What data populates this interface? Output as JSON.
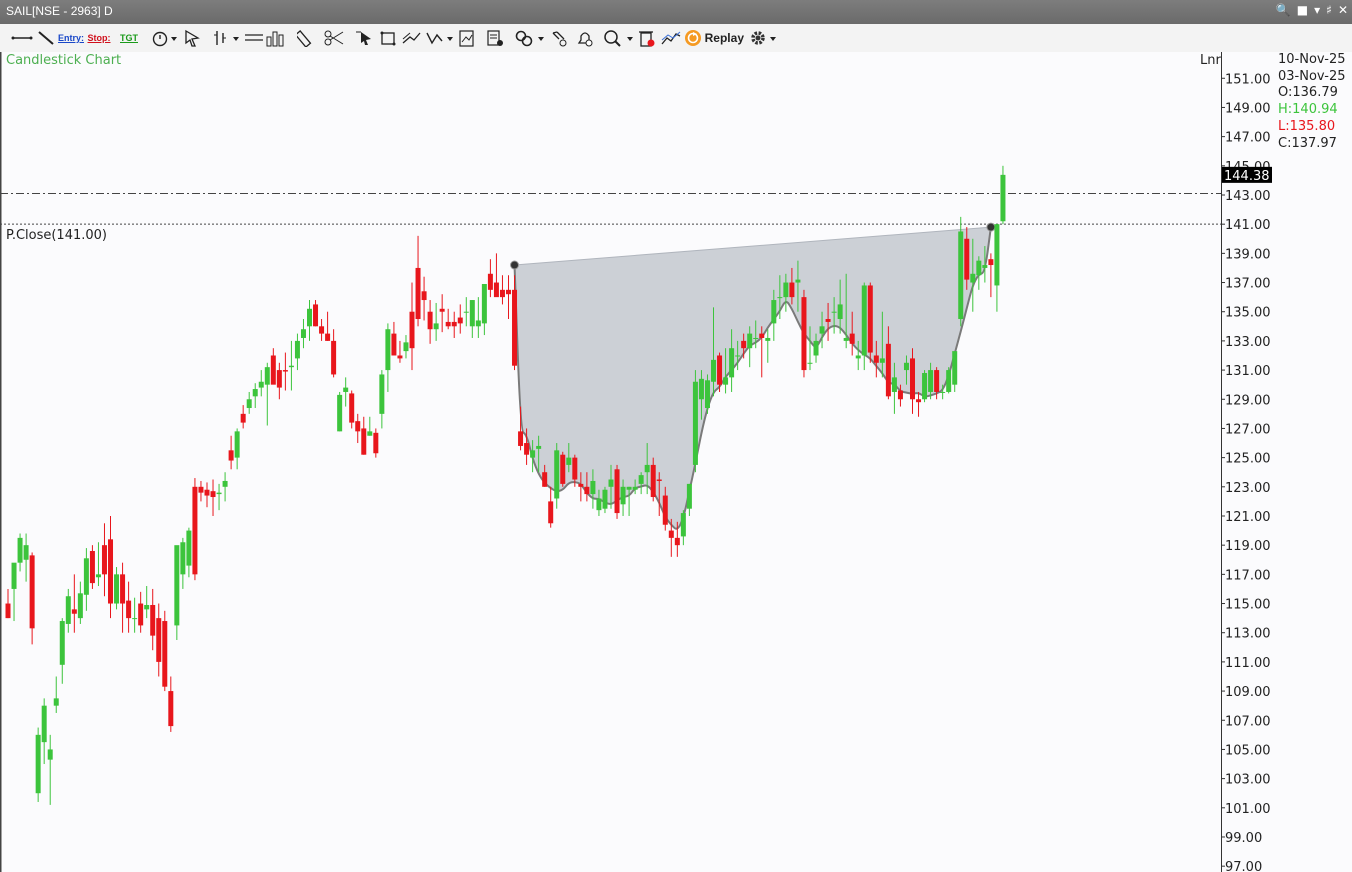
{
  "window": {
    "title": "SAIL[NSE - 2963] D"
  },
  "toolbar": {
    "entry_label": "Entry:",
    "stop_label": "Stop:",
    "tgt_label": "TGT",
    "replay_label": "Replay"
  },
  "header": {
    "chart_label": "Candlestick Chart",
    "scale_label": "Lnr",
    "date_current": "10-Nov-25",
    "date_hover": "03-Nov-25",
    "open": "O:136.79",
    "high": "H:140.94",
    "low": "L:135.80",
    "close": "C:137.97",
    "prev_close": "P.Close(141.00)",
    "last_price": "144.38"
  },
  "colors": {
    "up": "#3cc43c",
    "down": "#e8161c",
    "pattern_fill": "#c3c8cf",
    "pattern_stroke": "#7a7a7a",
    "accent": "#4caf50"
  },
  "chart_data": {
    "type": "candlestick",
    "ylim": [
      96.6,
      152.8
    ],
    "y_ticks": [
      "151.00",
      "149.00",
      "147.00",
      "145.00",
      "143.00",
      "141.00",
      "139.00",
      "137.00",
      "135.00",
      "133.00",
      "131.00",
      "129.00",
      "127.00",
      "125.00",
      "123.00",
      "121.00",
      "119.00",
      "117.00",
      "115.00",
      "113.00",
      "111.00",
      "109.00",
      "107.00",
      "105.00",
      "103.00",
      "101.00",
      "99.00",
      "97.00"
    ],
    "reference_lines": [
      {
        "name": "P.Close",
        "value": 141.0,
        "style": "dotted"
      },
      {
        "value": 143.1,
        "style": "dash-dot"
      }
    ],
    "candles": [
      [
        115.0,
        116.0,
        114.0,
        114.0
      ],
      [
        116.0,
        117.6,
        113.8,
        117.8
      ],
      [
        117.8,
        119.8,
        117.2,
        119.5
      ],
      [
        118.0,
        119.8,
        116.5,
        119.0
      ],
      [
        118.3,
        118.5,
        112.2,
        113.3
      ],
      [
        102.0,
        106.5,
        101.4,
        106.0
      ],
      [
        105.5,
        108.5,
        104.0,
        108.0
      ],
      [
        104.3,
        106.0,
        101.2,
        105.0
      ],
      [
        108.0,
        110.0,
        107.5,
        108.5
      ],
      [
        110.8,
        114.0,
        109.5,
        113.8
      ],
      [
        113.6,
        116.0,
        113.0,
        115.5
      ],
      [
        114.6,
        117.0,
        113.0,
        114.3
      ],
      [
        114.0,
        116.5,
        113.6,
        115.7
      ],
      [
        115.6,
        118.8,
        114.5,
        118.1
      ],
      [
        118.6,
        119.0,
        116.0,
        116.4
      ],
      [
        116.8,
        119.2,
        116.2,
        117.0
      ],
      [
        119.0,
        120.5,
        115.5,
        117.0
      ],
      [
        119.4,
        121.0,
        114.0,
        115.0
      ],
      [
        115.0,
        117.5,
        114.6,
        117.0
      ],
      [
        117.0,
        117.8,
        113.0,
        115.0
      ],
      [
        115.2,
        116.5,
        113.0,
        114.0
      ],
      [
        114.0,
        115.4,
        113.0,
        114.0
      ],
      [
        115.0,
        115.8,
        113.0,
        113.5
      ],
      [
        114.6,
        116.2,
        114.0,
        114.9
      ],
      [
        114.9,
        116.0,
        111.8,
        112.8
      ],
      [
        114.0,
        115.0,
        110.0,
        111.0
      ],
      [
        113.8,
        114.5,
        109.0,
        109.3
      ],
      [
        109.0,
        110.0,
        106.2,
        106.6
      ],
      [
        113.5,
        116.0,
        112.5,
        119.0
      ],
      [
        117.0,
        119.5,
        116.0,
        119.2
      ],
      [
        117.6,
        120.2,
        116.8,
        120.0
      ],
      [
        123.0,
        123.6,
        116.6,
        117.0
      ],
      [
        123.0,
        123.4,
        122.0,
        122.6
      ],
      [
        122.8,
        123.3,
        121.6,
        122.4
      ],
      [
        122.7,
        123.5,
        121.0,
        122.3
      ],
      [
        122.5,
        123.2,
        121.4,
        122.6
      ],
      [
        123.0,
        124.0,
        122.0,
        123.4
      ],
      [
        125.5,
        126.5,
        124.2,
        124.8
      ],
      [
        125.0,
        127.0,
        124.2,
        126.8
      ],
      [
        128.0,
        128.6,
        127.0,
        127.4
      ],
      [
        128.4,
        129.5,
        128.0,
        129.0
      ],
      [
        129.2,
        130.1,
        128.4,
        129.7
      ],
      [
        129.8,
        131.0,
        129.2,
        130.2
      ],
      [
        130.0,
        131.5,
        127.2,
        131.2
      ],
      [
        132.0,
        132.5,
        130.5,
        130.0
      ],
      [
        131.0,
        131.5,
        129.0,
        129.8
      ],
      [
        131.0,
        132.2,
        129.6,
        130.9
      ],
      [
        131.2,
        133.0,
        129.6,
        131.3
      ],
      [
        131.8,
        133.5,
        131.0,
        133.0
      ],
      [
        133.2,
        134.5,
        132.5,
        133.8
      ],
      [
        134.0,
        135.8,
        133.0,
        135.2
      ],
      [
        135.5,
        135.8,
        134.0,
        134.0
      ],
      [
        134.0,
        134.5,
        133.0,
        133.5
      ],
      [
        133.5,
        135.0,
        133.0,
        133.0
      ],
      [
        133.0,
        133.8,
        130.5,
        130.7
      ],
      [
        126.8,
        129.5,
        126.8,
        129.3
      ],
      [
        129.5,
        130.5,
        128.5,
        129.8
      ],
      [
        129.4,
        129.6,
        127.0,
        127.4
      ],
      [
        127.5,
        128.0,
        126.0,
        126.8
      ],
      [
        127.0,
        127.8,
        125.2,
        125.2
      ],
      [
        126.5,
        127.8,
        126.5,
        126.8
      ],
      [
        126.7,
        127.0,
        125.0,
        125.3
      ],
      [
        128.0,
        131.0,
        127.0,
        130.7
      ],
      [
        131.0,
        134.2,
        129.5,
        133.8
      ],
      [
        133.5,
        134.3,
        132.0,
        132.0
      ],
      [
        132.0,
        133.0,
        131.5,
        131.8
      ],
      [
        132.3,
        133.4,
        131.8,
        132.9
      ],
      [
        135.0,
        137.0,
        131.0,
        132.5
      ],
      [
        138.0,
        140.2,
        134.0,
        134.5
      ],
      [
        136.4,
        137.4,
        134.4,
        135.8
      ],
      [
        135.0,
        135.8,
        132.8,
        133.8
      ],
      [
        133.8,
        135.6,
        133.0,
        134.2
      ],
      [
        135.2,
        136.2,
        133.6,
        135.0
      ],
      [
        134.3,
        135.2,
        133.8,
        134.0
      ],
      [
        134.3,
        135.0,
        133.2,
        134.0
      ],
      [
        134.6,
        135.5,
        133.5,
        134.2
      ],
      [
        135.0,
        136.0,
        134.0,
        135.0
      ],
      [
        134.0,
        135.8,
        133.2,
        135.8
      ],
      [
        134.0,
        136.0,
        133.2,
        134.4
      ],
      [
        134.2,
        136.3,
        133.4,
        136.9
      ],
      [
        137.6,
        138.6,
        136.0,
        136.5
      ],
      [
        137.0,
        139.0,
        136.3,
        136.0
      ],
      [
        136.5,
        137.5,
        135.5,
        136.0
      ],
      [
        136.5,
        137.5,
        134.5,
        136.2
      ],
      [
        136.5,
        137.5,
        131.0,
        131.3
      ],
      [
        126.8,
        128.5,
        125.5,
        125.8
      ],
      [
        126.0,
        127.0,
        124.5,
        125.2
      ],
      [
        125.0,
        126.2,
        124.0,
        125.5
      ],
      [
        125.6,
        126.5,
        124.0,
        125.8
      ],
      [
        124.0,
        124.5,
        123.0,
        123.0
      ],
      [
        122.0,
        123.0,
        120.2,
        120.5
      ],
      [
        122.2,
        126.0,
        121.5,
        125.5
      ],
      [
        125.2,
        125.4,
        123.0,
        123.2
      ],
      [
        124.5,
        126.0,
        124.0,
        125.0
      ],
      [
        125.0,
        125.2,
        123.0,
        123.5
      ],
      [
        123.2,
        124.0,
        122.0,
        123.0
      ],
      [
        123.0,
        124.0,
        122.0,
        122.5
      ],
      [
        122.5,
        124.2,
        121.5,
        123.4
      ],
      [
        121.4,
        122.8,
        121.0,
        122.2
      ],
      [
        121.5,
        123.0,
        121.2,
        122.8
      ],
      [
        123.0,
        124.5,
        121.5,
        123.5
      ],
      [
        124.2,
        124.5,
        120.8,
        121.2
      ],
      [
        121.8,
        123.5,
        121.0,
        123.0
      ],
      [
        122.8,
        123.0,
        121.0,
        123.0
      ],
      [
        122.8,
        123.5,
        122.5,
        123.0
      ],
      [
        123.2,
        124.0,
        122.5,
        123.8
      ],
      [
        124.0,
        126.0,
        122.5,
        124.5
      ],
      [
        124.5,
        125.0,
        122.0,
        122.3
      ],
      [
        123.5,
        124.0,
        121.0,
        123.4
      ],
      [
        122.4,
        123.0,
        120.0,
        120.4
      ],
      [
        120.0,
        120.8,
        118.2,
        119.5
      ],
      [
        119.5,
        120.6,
        118.2,
        119.0
      ],
      [
        119.6,
        121.4,
        119.0,
        121.2
      ],
      [
        121.5,
        123.2,
        121.0,
        123.2
      ],
      [
        124.5,
        131.0,
        124.0,
        130.2
      ],
      [
        129.0,
        131.0,
        127.6,
        130.4
      ],
      [
        128.4,
        130.7,
        128.0,
        130.3
      ],
      [
        130.2,
        135.3,
        129.2,
        131.7
      ],
      [
        132.0,
        132.2,
        129.5,
        130.0
      ],
      [
        130.0,
        132.5,
        129.4,
        130.5
      ],
      [
        130.5,
        133.8,
        129.5,
        132.5
      ],
      [
        132.0,
        133.0,
        131.0,
        132.0
      ],
      [
        133.0,
        133.5,
        131.8,
        132.5
      ],
      [
        132.5,
        134.0,
        131.2,
        133.5
      ],
      [
        133.2,
        134.4,
        132.5,
        133.2
      ],
      [
        133.5,
        134.0,
        130.5,
        133.2
      ],
      [
        133.0,
        133.8,
        131.5,
        133.2
      ],
      [
        134.2,
        136.5,
        133.0,
        135.8
      ],
      [
        136.0,
        137.5,
        134.5,
        136.0
      ],
      [
        136.0,
        137.6,
        135.0,
        137.0
      ],
      [
        137.0,
        138.0,
        135.5,
        136.0
      ],
      [
        137.0,
        138.5,
        135.0,
        137.2
      ],
      [
        136.0,
        136.5,
        130.5,
        131.0
      ],
      [
        131.5,
        134.0,
        131.0,
        131.5
      ],
      [
        132.0,
        133.5,
        131.5,
        133.0
      ],
      [
        133.5,
        135.0,
        132.5,
        134.0
      ],
      [
        134.5,
        135.6,
        133.0,
        134.3
      ],
      [
        135.0,
        136.0,
        133.5,
        135.0
      ],
      [
        134.5,
        137.2,
        133.5,
        135.5
      ],
      [
        133.0,
        137.6,
        132.5,
        133.2
      ],
      [
        133.5,
        135.0,
        132.0,
        132.8
      ],
      [
        131.8,
        133.0,
        131.0,
        132.0
      ],
      [
        132.0,
        137.0,
        131.0,
        136.8
      ],
      [
        136.8,
        137.0,
        131.5,
        132.2
      ],
      [
        132.0,
        133.0,
        130.5,
        131.5
      ],
      [
        131.5,
        135.0,
        130.5,
        131.8
      ],
      [
        132.8,
        134.0,
        129.0,
        129.2
      ],
      [
        129.5,
        131.5,
        128.0,
        130.5
      ],
      [
        129.6,
        130.0,
        128.5,
        129.0
      ],
      [
        131.0,
        132.0,
        130.0,
        131.5
      ],
      [
        131.8,
        132.5,
        128.0,
        129.0
      ],
      [
        129.0,
        129.5,
        127.8,
        128.8
      ],
      [
        129.0,
        131.0,
        128.8,
        130.8
      ],
      [
        129.5,
        131.5,
        129.0,
        131.0
      ],
      [
        131.0,
        131.2,
        129.0,
        129.5
      ],
      [
        129.5,
        130.0,
        129.0,
        129.5
      ],
      [
        129.5,
        131.2,
        129.4,
        131.0
      ],
      [
        130.0,
        132.0,
        129.5,
        132.3
      ],
      [
        134.5,
        141.5,
        134.0,
        140.5
      ],
      [
        140.0,
        140.8,
        136.5,
        137.2
      ],
      [
        137.0,
        140.0,
        135.0,
        137.6
      ],
      [
        137.5,
        138.8,
        136.5,
        138.5
      ],
      [
        138.0,
        139.5,
        137.0,
        138.2
      ],
      [
        138.6,
        139.0,
        136.0,
        138.2
      ],
      [
        136.8,
        141.0,
        135.0,
        141.0
      ],
      [
        141.2,
        145.0,
        141.0,
        144.38
      ]
    ],
    "pattern": {
      "name": "cup and handle",
      "rim_start": [
        0,
        138.2
      ],
      "rim_end": [
        0,
        140.8
      ]
    }
  }
}
